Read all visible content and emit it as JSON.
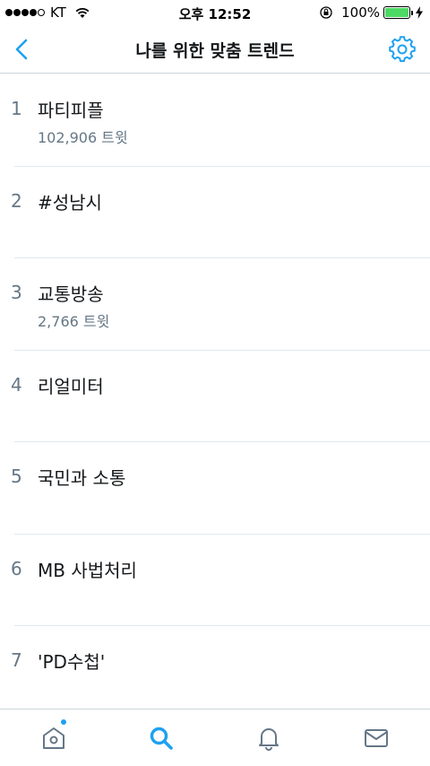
{
  "status_bar": {
    "carrier": "KT",
    "time": "오후 12:52",
    "battery": "100%"
  },
  "nav": {
    "title": "나를 위한 맞춤 트렌드",
    "back_icon": "chevron-left-icon",
    "settings_icon": "gear-icon"
  },
  "trends": [
    {
      "rank": "1",
      "name": "파티피플",
      "meta": "102,906 트윗"
    },
    {
      "rank": "2",
      "name": "#성남시",
      "meta": ""
    },
    {
      "rank": "3",
      "name": "교통방송",
      "meta": "2,766 트윗"
    },
    {
      "rank": "4",
      "name": "리얼미터",
      "meta": ""
    },
    {
      "rank": "5",
      "name": "국민과 소통",
      "meta": ""
    },
    {
      "rank": "6",
      "name": "MB 사법처리",
      "meta": ""
    },
    {
      "rank": "7",
      "name": "'PD수첩'",
      "meta": ""
    }
  ],
  "tab_bar": {
    "tabs": [
      {
        "icon": "home-icon",
        "active": false,
        "has_badge": true
      },
      {
        "icon": "search-icon",
        "active": true,
        "has_badge": false
      },
      {
        "icon": "bell-icon",
        "active": false,
        "has_badge": false
      },
      {
        "icon": "mail-icon",
        "active": false,
        "has_badge": false
      }
    ]
  },
  "colors": {
    "accent": "#1da1f2",
    "secondary_text": "#657786",
    "primary_text": "#14171a",
    "battery": "#4cd964"
  }
}
